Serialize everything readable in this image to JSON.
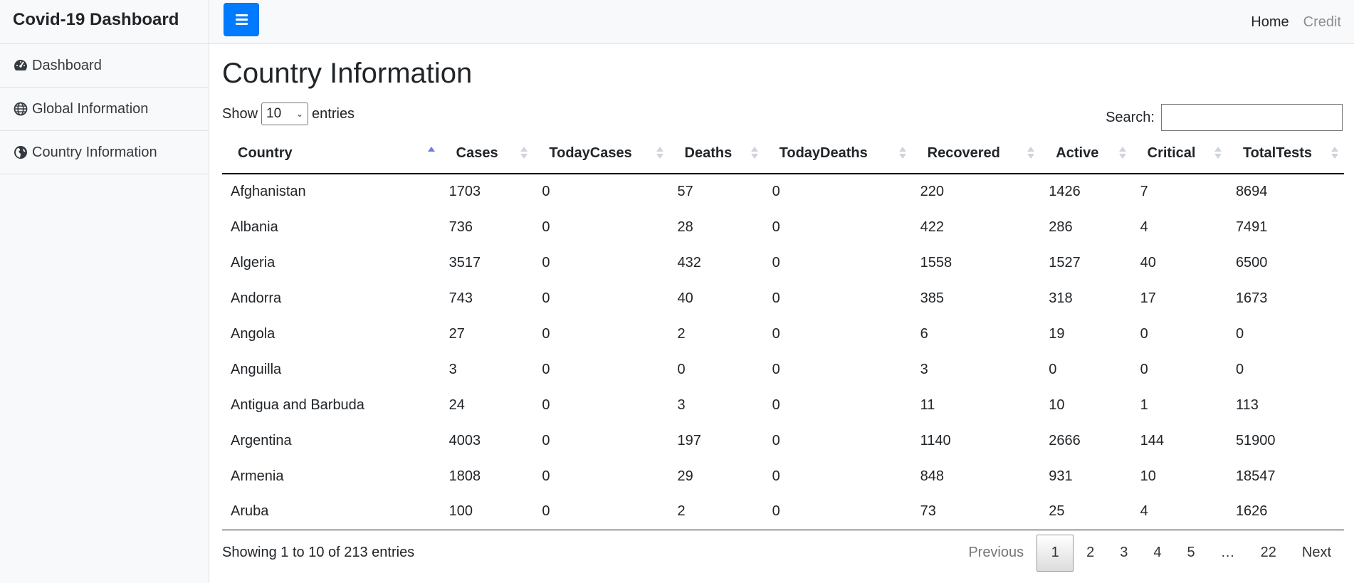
{
  "sidebar": {
    "title": "Covid-19 Dashboard",
    "items": [
      {
        "label": "Dashboard",
        "icon": "tachometer-icon"
      },
      {
        "label": "Global Information",
        "icon": "globe-icon"
      },
      {
        "label": "Country Information",
        "icon": "globe-americas-icon"
      }
    ]
  },
  "topbar": {
    "toggle_icon": "hamburger-icon",
    "nav": {
      "home": "Home",
      "credit": "Credit"
    }
  },
  "page": {
    "title": "Country Information"
  },
  "table_controls": {
    "show_label": "Show",
    "entries_value": "10",
    "entries_label": "entries",
    "search_label": "Search:",
    "search_value": ""
  },
  "table": {
    "columns": [
      "Country",
      "Cases",
      "TodayCases",
      "Deaths",
      "TodayDeaths",
      "Recovered",
      "Active",
      "Critical",
      "TotalTests"
    ],
    "sorted_column": "Country",
    "rows": [
      [
        "Afghanistan",
        "1703",
        "0",
        "57",
        "0",
        "220",
        "1426",
        "7",
        "8694"
      ],
      [
        "Albania",
        "736",
        "0",
        "28",
        "0",
        "422",
        "286",
        "4",
        "7491"
      ],
      [
        "Algeria",
        "3517",
        "0",
        "432",
        "0",
        "1558",
        "1527",
        "40",
        "6500"
      ],
      [
        "Andorra",
        "743",
        "0",
        "40",
        "0",
        "385",
        "318",
        "17",
        "1673"
      ],
      [
        "Angola",
        "27",
        "0",
        "2",
        "0",
        "6",
        "19",
        "0",
        "0"
      ],
      [
        "Anguilla",
        "3",
        "0",
        "0",
        "0",
        "3",
        "0",
        "0",
        "0"
      ],
      [
        "Antigua and Barbuda",
        "24",
        "0",
        "3",
        "0",
        "11",
        "10",
        "1",
        "113"
      ],
      [
        "Argentina",
        "4003",
        "0",
        "197",
        "0",
        "1140",
        "2666",
        "144",
        "51900"
      ],
      [
        "Armenia",
        "1808",
        "0",
        "29",
        "0",
        "848",
        "931",
        "10",
        "18547"
      ],
      [
        "Aruba",
        "100",
        "0",
        "2",
        "0",
        "73",
        "25",
        "4",
        "1626"
      ]
    ]
  },
  "footer": {
    "info": "Showing 1 to 10 of 213 entries",
    "pagination": {
      "previous": "Previous",
      "pages": [
        "1",
        "2",
        "3",
        "4",
        "5",
        "…",
        "22"
      ],
      "current": "1",
      "next": "Next"
    }
  },
  "colors": {
    "accent": "#007bff",
    "sidebar_bg": "#f8f9fa",
    "sort_active": "#6b7fdc"
  }
}
